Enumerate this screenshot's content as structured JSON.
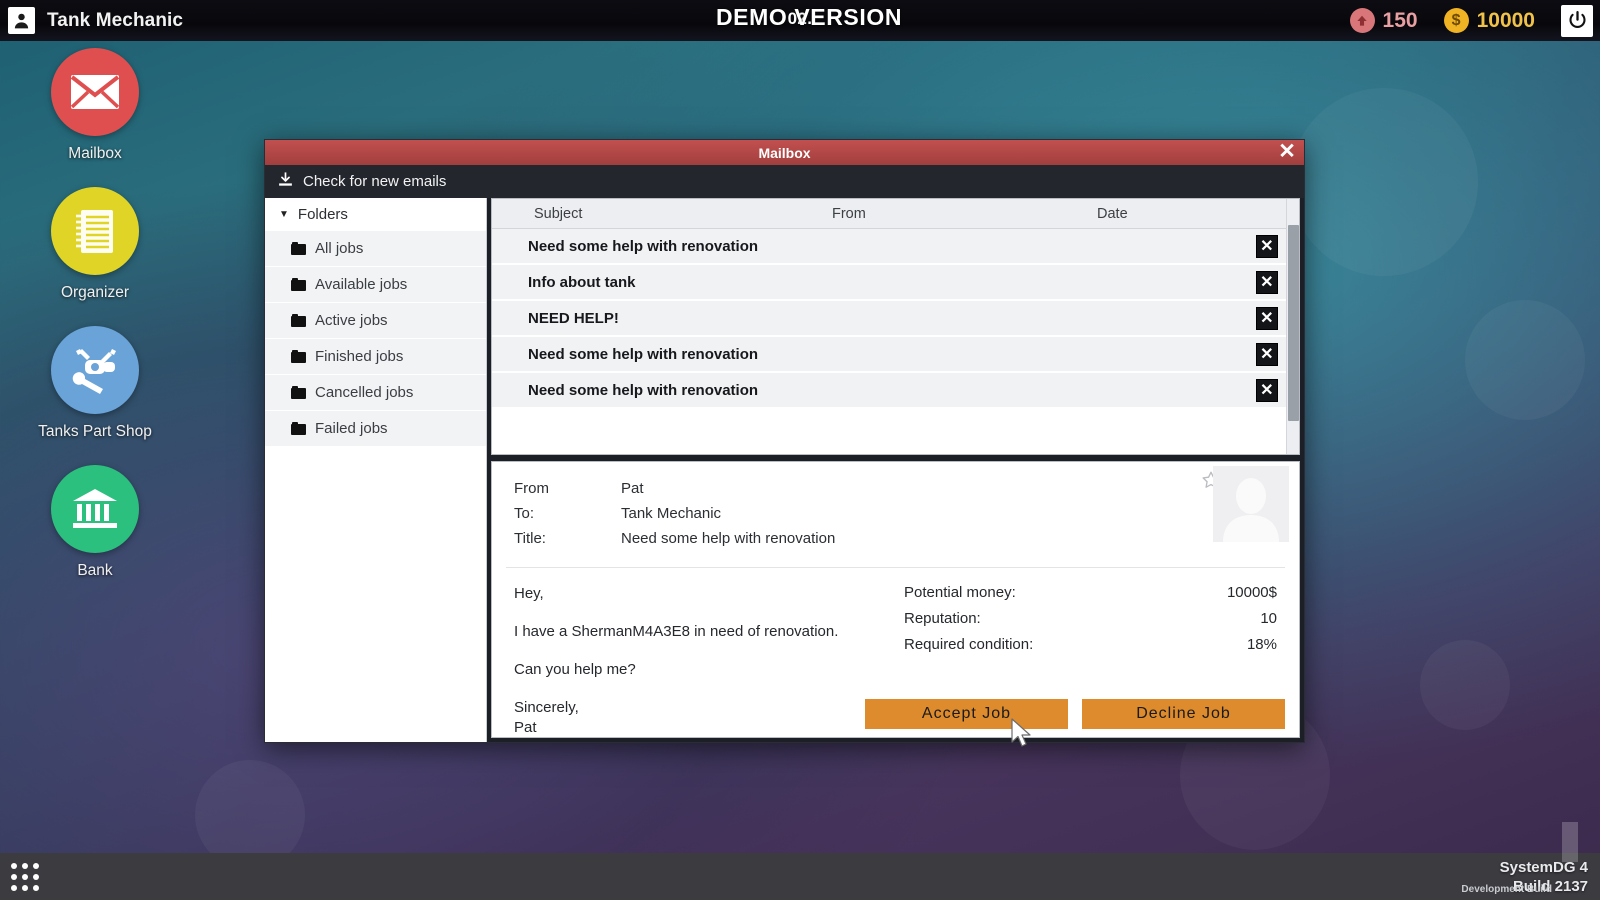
{
  "topbar": {
    "user_icon": "user-avatar-icon",
    "username": "Tank Mechanic",
    "center_level": "02.",
    "demo_label": "DEMO VERSION",
    "reputation_icon": "reputation-arrow-icon",
    "reputation_value": "150",
    "money_icon": "dollar-coin-icon",
    "money_value": "10000",
    "power_icon": "power-icon",
    "colors": {
      "reputation": "#d9767a",
      "money": "#f0b323"
    }
  },
  "desktop": {
    "icons": [
      {
        "label": "Mailbox",
        "icon": "envelope-icon",
        "color": "#e04f4f"
      },
      {
        "label": "Organizer",
        "icon": "notebook-icon",
        "color": "#e0d526"
      },
      {
        "label": "Tanks Part Shop",
        "icon": "engine-wrench-icon",
        "color": "#6aa3d8"
      },
      {
        "label": "Bank",
        "icon": "bank-building-icon",
        "color": "#2bc07e"
      }
    ]
  },
  "mailbox": {
    "title": "Mailbox",
    "close_label": "✕",
    "toolbar": {
      "check_label": "Check for new emails",
      "icon": "download-inbox-icon"
    },
    "folders": {
      "header": "Folders",
      "caret": "▼",
      "items": [
        {
          "label": "All jobs"
        },
        {
          "label": "Available jobs"
        },
        {
          "label": "Active jobs"
        },
        {
          "label": "Finished jobs"
        },
        {
          "label": "Cancelled jobs"
        },
        {
          "label": "Failed jobs"
        }
      ]
    },
    "list": {
      "columns": {
        "subject": "Subject",
        "from": "From",
        "date": "Date"
      },
      "delete_glyph": "✕",
      "rows": [
        {
          "subject": "Need some help with renovation",
          "from": "",
          "date": ""
        },
        {
          "subject": "Info about tank",
          "from": "",
          "date": ""
        },
        {
          "subject": "NEED HELP!",
          "from": "",
          "date": ""
        },
        {
          "subject": "Need some help with renovation",
          "from": "",
          "date": ""
        },
        {
          "subject": "Need some help with renovation",
          "from": "",
          "date": ""
        }
      ]
    },
    "detail": {
      "from_key": "From",
      "from_value": "Pat",
      "to_key": "To:",
      "to_value": "Tank Mechanic",
      "title_key": "Title:",
      "title_value": "Need some help with renovation",
      "star_icon": "favorite-star-icon",
      "avatar_icon": "contact-avatar-icon",
      "message": {
        "greeting": "Hey,",
        "line1": "I have a ShermanM4A3E8 in need of renovation.",
        "line2": "Can you help me?",
        "signoff": "Sincerely,",
        "signature": "Pat"
      },
      "info": [
        {
          "key": "Potential money:",
          "value": "10000$"
        },
        {
          "key": "Reputation:",
          "value": "10"
        },
        {
          "key": "Required condition:",
          "value": "18%"
        }
      ],
      "accept_label": "Accept Job",
      "decline_label": "Decline Job",
      "accent_color": "#dd8b2c"
    }
  },
  "bottombar": {
    "apps_icon": "apps-grid-icon",
    "system_line": "SystemDG 4",
    "build_line": "Build 2137",
    "watermark": "Development Build"
  }
}
